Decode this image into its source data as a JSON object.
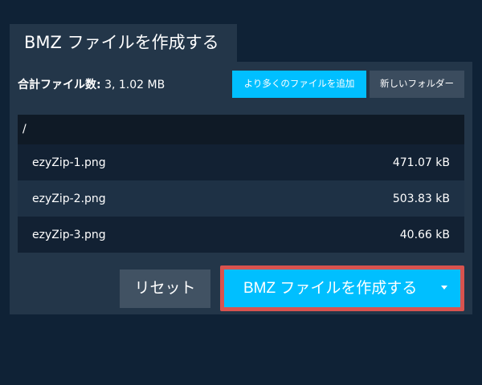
{
  "tab": {
    "title": "BMZ ファイルを作成する"
  },
  "summary": {
    "label": "合計ファイル数:",
    "value": "3, 1.02 MB"
  },
  "toolbar": {
    "add_label": "より多くのファイルを追加",
    "folder_label": "新しいフォルダー"
  },
  "filelist": {
    "path": "/",
    "files": [
      {
        "name": "ezyZip-1.png",
        "size": "471.07 kB"
      },
      {
        "name": "ezyZip-2.png",
        "size": "503.83 kB"
      },
      {
        "name": "ezyZip-3.png",
        "size": "40.66 kB"
      }
    ]
  },
  "actions": {
    "reset_label": "リセット",
    "create_label": "BMZ ファイルを作成する"
  },
  "colors": {
    "background": "#0f2236",
    "panel": "#233649",
    "accent": "#00bfff",
    "highlight": "#d9534f"
  }
}
